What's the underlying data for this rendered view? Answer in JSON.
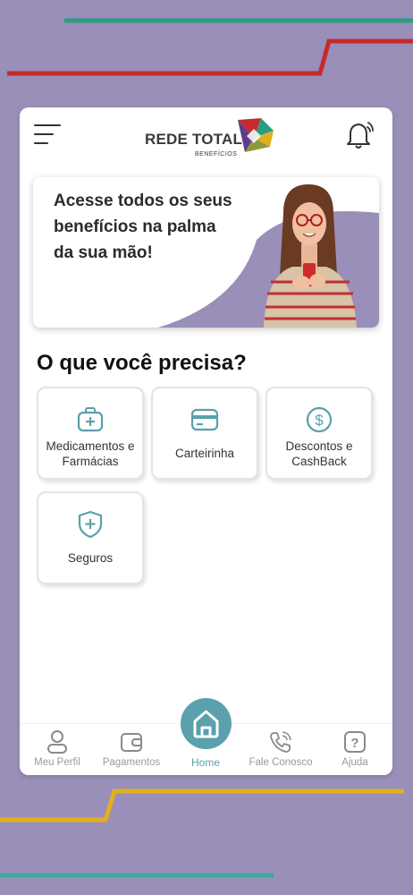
{
  "colors": {
    "background": "#9a8fb8",
    "accent": "#5aa0ad",
    "green_line": "#2a9d7f",
    "red_line": "#c62a2a",
    "yellow_line": "#e0b020",
    "teal_line": "#3fa7a0"
  },
  "header": {
    "logo_text": "REDE TOTAL",
    "logo_subtext": "BENEFÍCIOS",
    "menu_icon": "hamburger-menu-icon",
    "notification_icon": "bell-icon"
  },
  "banner": {
    "text": "Acesse todos os seus benefícios na palma da sua mão!"
  },
  "section": {
    "title": "O que você precisa?"
  },
  "services": [
    {
      "label": "Medicamentos e Farmácias",
      "icon": "medical-bag-icon"
    },
    {
      "label": "Carteirinha",
      "icon": "card-icon"
    },
    {
      "label": "Descontos e CashBack",
      "icon": "dollar-coin-icon"
    },
    {
      "label": "Seguros",
      "icon": "shield-plus-icon"
    }
  ],
  "nav": {
    "profile": "Meu Perfil",
    "payments": "Pagamentos",
    "home": "Home",
    "contact": "Fale Conosco",
    "help": "Ajuda"
  }
}
